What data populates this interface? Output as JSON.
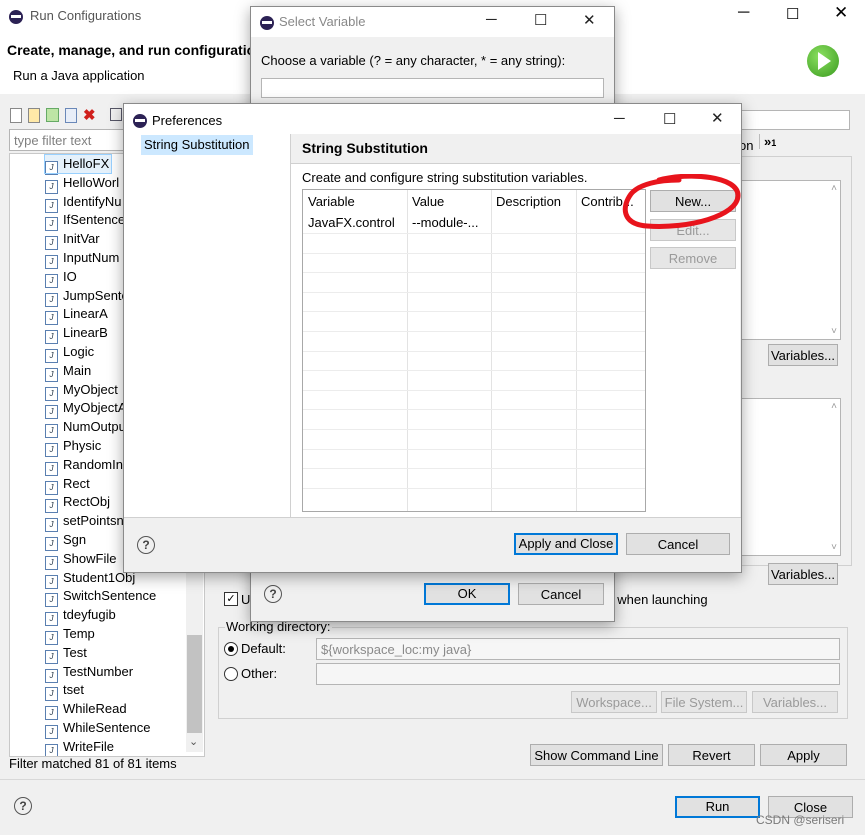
{
  "run_config": {
    "title": "Run Configurations",
    "header": "Create, manage, and run configuration",
    "subheader": "Run a Java application",
    "filter_placeholder": "type filter text",
    "tree_items": [
      "HelloFX",
      "HelloWorl",
      "IdentifyNu",
      "IfSentence",
      "InitVar",
      "InputNum",
      "IO",
      "JumpSente",
      "LinearA",
      "LinearB",
      "Logic",
      "Main",
      "MyObject",
      "MyObjectA",
      "NumOutpu",
      "Physic",
      "RandomIn",
      "Rect",
      "RectObj",
      "setPointsn",
      "Sgn",
      "ShowFile",
      "Student1Obj",
      "SwitchSentence",
      "tdeyfugib",
      "Temp",
      "Test",
      "TestNumber",
      "tset",
      "WhileRead",
      "WhileSentence",
      "WriteFile"
    ],
    "filter_status": "Filter matched 81 of 81 items",
    "tab_partial": "on",
    "tab_more": "»",
    "tab_more_count": "1",
    "variables_label_1": "Variables...",
    "variables_label_2": "Variables...",
    "checkbox_prefix": "U",
    "checkbox_suffix": "t when launching",
    "working_directory_label": "Working directory:",
    "default_label": "Default:",
    "default_value": "${workspace_loc:my java}",
    "other_label": "Other:",
    "workspace_btn": "Workspace...",
    "filesystem_btn": "File System...",
    "variables_btn_3": "Variables...",
    "show_cmd": "Show Command Line",
    "revert": "Revert",
    "apply": "Apply",
    "run": "Run",
    "close": "Close"
  },
  "select_variable": {
    "title": "Select Variable",
    "prompt": "Choose a variable (? = any character, * = any string):",
    "input_value": "",
    "ok": "OK",
    "cancel": "Cancel"
  },
  "preferences": {
    "title": "Preferences",
    "nav_item": "String Substitution",
    "page_title": "String Substitution",
    "description": "Create and configure string substitution variables.",
    "columns": [
      "Variable",
      "Value",
      "Description",
      "Contrib..."
    ],
    "rows": [
      [
        "JavaFX.control",
        "--module-...",
        "",
        ""
      ]
    ],
    "new_btn": "New...",
    "edit_btn": "Edit...",
    "remove_btn": "Remove",
    "apply_close": "Apply and Close",
    "cancel": "Cancel"
  },
  "watermark": "CSDN @seriseri",
  "colors": {
    "accent": "#0078d7",
    "annotation": "#e8141c",
    "selection": "#cce8ff",
    "run_icon": "#4caf30"
  }
}
